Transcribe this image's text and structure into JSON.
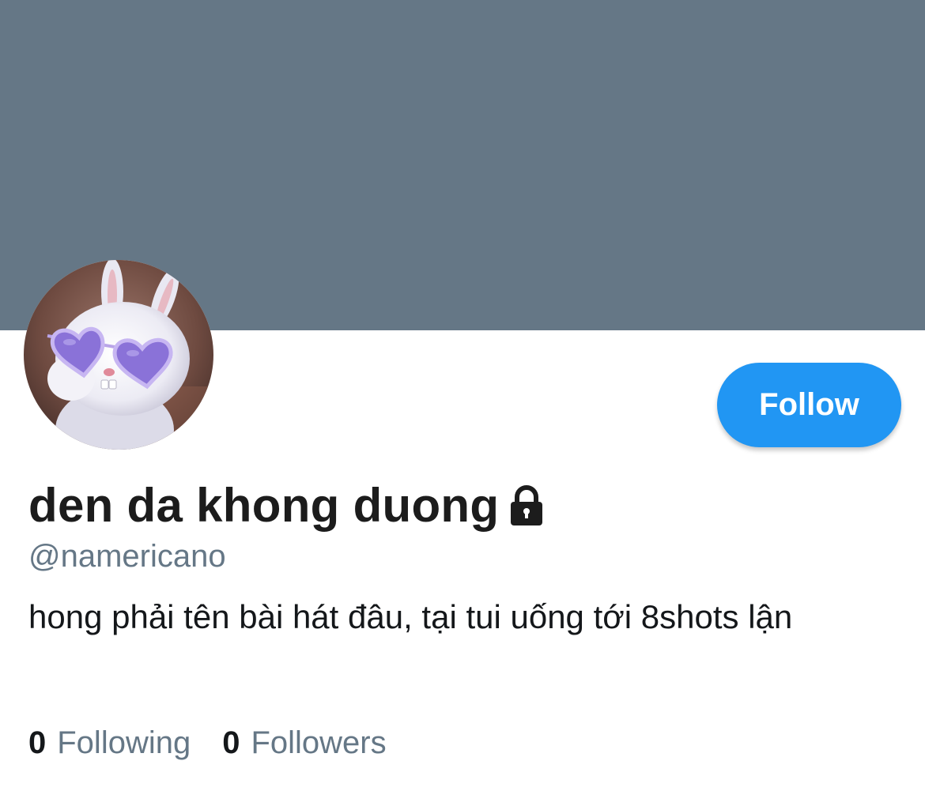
{
  "profile": {
    "banner_color": "#657786",
    "avatar": {
      "description_icon": "bunny-with-heart-sunglasses-avatar"
    },
    "display_name": "den da khong duong",
    "protected_icon": "lock-icon",
    "handle": "@namericano",
    "bio": "hong phải tên bài hát đâu, tại tui uống tới 8shots lận",
    "follow_button": {
      "label": "Follow",
      "color": "#2196f3"
    },
    "stats": {
      "following_count": "0",
      "following_label": "Following",
      "followers_count": "0",
      "followers_label": "Followers"
    }
  }
}
